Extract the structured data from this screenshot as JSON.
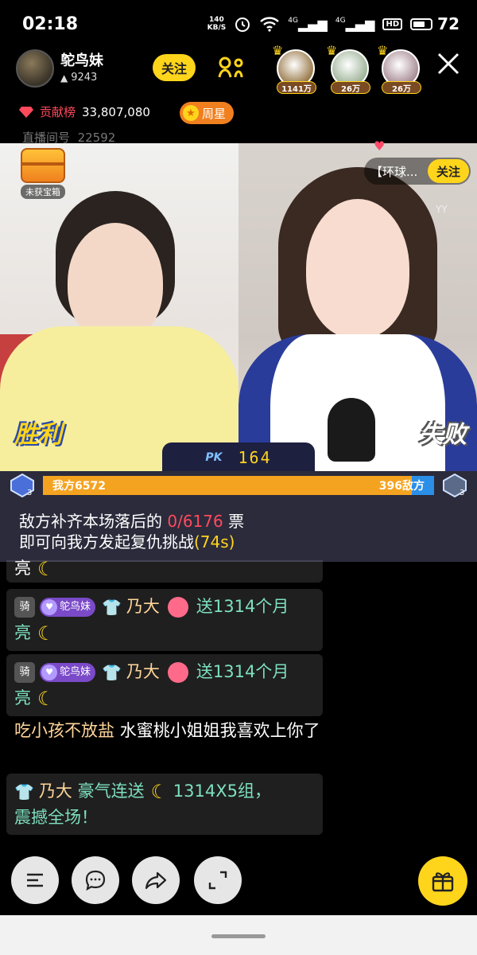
{
  "status_bar": {
    "time": "02:18",
    "net_speed_value": "140",
    "net_speed_unit": "KB/S",
    "sim1": "4G",
    "sim2": "4G",
    "hd": "HD",
    "battery": "72",
    "battery_level": 0.72
  },
  "anchor": {
    "name": "鸵鸟妹",
    "fans": "9243",
    "follow_label": "关注"
  },
  "top_viewers": [
    {
      "tag": "1141万",
      "color": "#9a7a4a"
    },
    {
      "tag": "26万",
      "color": "#9fb49a"
    },
    {
      "tag": "26万",
      "color": "#a88c96"
    }
  ],
  "contribution": {
    "label": "贡献榜",
    "value": "33,807,080",
    "week_star": "周星"
  },
  "room": {
    "label": "直播间号",
    "id": "22592"
  },
  "treasure": {
    "label": "未获宝箱"
  },
  "partner": {
    "name": "【环球...",
    "follow_label": "关注",
    "watermark": "YY"
  },
  "pk": {
    "win_label": "胜利",
    "lose_label": "失败",
    "score": "164",
    "ours_text": "我方6572",
    "theirs_text": "396敌方",
    "ours_value": 6572,
    "theirs_value": 396,
    "rank_level": "3"
  },
  "revenge": {
    "line1_a": "敌方补齐本场落后的 ",
    "line1_b": "0/6176",
    "line1_c": " 票",
    "line2_a": "即可向我方发起复仇挑战",
    "line2_b": "(74s)"
  },
  "chat": {
    "partial_tail": "亮",
    "gift_messages": [
      {
        "level": "骑",
        "fan_name": "鸵鸟妹",
        "user": "乃大",
        "gift_text": "送1314个月",
        "tail": "亮"
      },
      {
        "level": "骑",
        "fan_name": "鸵鸟妹",
        "user": "乃大",
        "gift_text": "送1314个月",
        "tail": "亮"
      }
    ],
    "plain": {
      "user": "吃小孩不放盐",
      "text": "水蜜桃小姐姐我喜欢上你了"
    },
    "combo": {
      "user": "乃大",
      "pre": "豪气连送",
      "post": "1314X5组，",
      "line2": "震撼全场！"
    }
  },
  "colors": {
    "accent": "#ffd51c",
    "ours": "#f4a320",
    "theirs": "#2b8fe8",
    "alert": "#ff4a5c"
  }
}
